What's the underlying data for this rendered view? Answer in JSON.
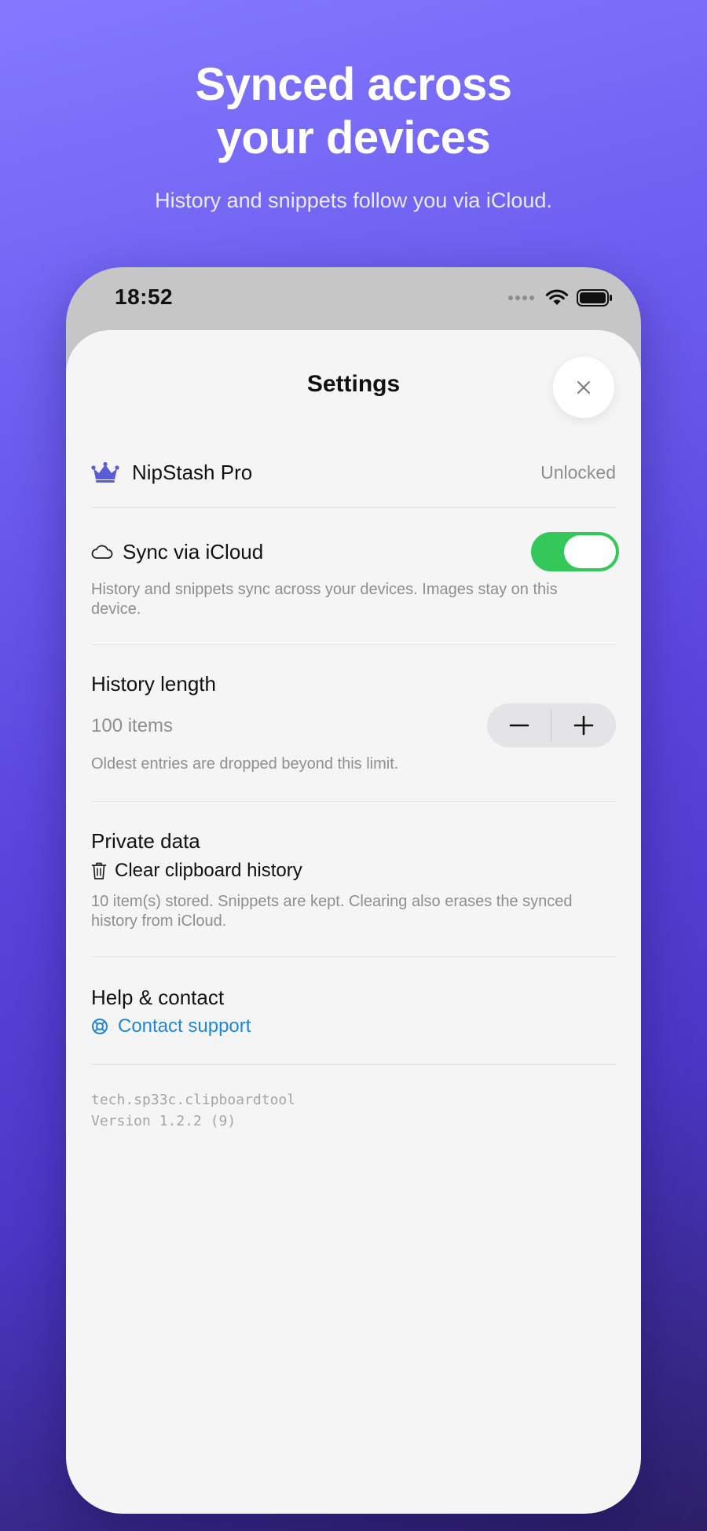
{
  "hero": {
    "title_line1": "Synced across",
    "title_line2": "your devices",
    "subtitle": "History and snippets follow you via iCloud."
  },
  "status_bar": {
    "time": "18:52",
    "icons": [
      "cellular-dots-icon",
      "wifi-icon",
      "battery-icon"
    ]
  },
  "sheet": {
    "title": "Settings",
    "close_icon": "close-icon"
  },
  "pro": {
    "icon": "crown-icon",
    "label": "NipStash Pro",
    "value": "Unlocked"
  },
  "sync": {
    "icon": "cloud-icon",
    "label": "Sync via iCloud",
    "enabled": true,
    "description": "History and snippets sync across your devices. Images stay on this device."
  },
  "history": {
    "title": "History length",
    "value": "100 items",
    "description": "Oldest entries are dropped beyond this limit.",
    "decrement_icon": "minus-icon",
    "increment_icon": "plus-icon"
  },
  "private_data": {
    "title": "Private data",
    "clear_icon": "trash-icon",
    "clear_label": "Clear clipboard history",
    "description": "10 item(s) stored. Snippets are kept. Clearing also erases the synced history from iCloud."
  },
  "help": {
    "title": "Help & contact",
    "contact_icon": "lifebuoy-icon",
    "contact_label": "Contact support"
  },
  "footer": {
    "bundle_id": "tech.sp33c.clipboardtool",
    "version": "Version 1.2.2 (9)"
  },
  "colors": {
    "accent_link": "#1f86d8",
    "toggle_on": "#34c759",
    "crown": "#5b5bd6"
  }
}
